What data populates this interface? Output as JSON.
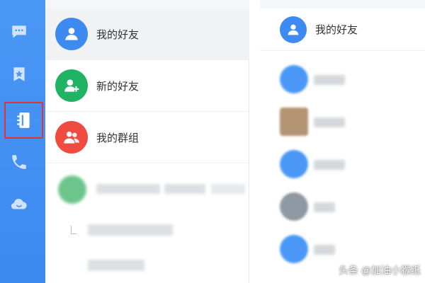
{
  "nav": {
    "items": [
      {
        "icon": "chat-bubble-icon",
        "active": false
      },
      {
        "icon": "star-bookmark-icon",
        "active": false
      },
      {
        "icon": "contacts-book-icon",
        "active": true
      },
      {
        "icon": "phone-icon",
        "active": false
      },
      {
        "icon": "cloud-icon",
        "active": false
      }
    ]
  },
  "middle": {
    "entries": [
      {
        "label": "我的好友",
        "icon": "user-icon",
        "color": "#3d8af0"
      },
      {
        "label": "新的好友",
        "icon": "add-user-icon",
        "color": "#21b364"
      },
      {
        "label": "我的群组",
        "icon": "group-icon",
        "color": "#f04b3f"
      }
    ]
  },
  "right": {
    "title": "我的好友"
  },
  "watermark": "头条 @加油小猴纸",
  "colors": {
    "nav_bg": "#3d8af0",
    "highlight_border": "#e23333",
    "friend_blue": "#3d8af0",
    "new_friend_green": "#21b364",
    "group_red": "#f04b3f"
  }
}
